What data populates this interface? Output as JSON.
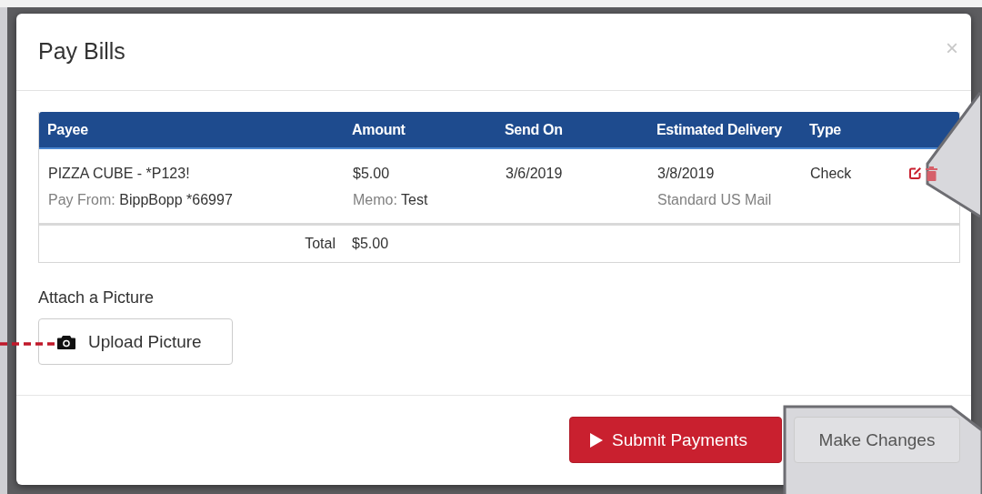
{
  "dialog": {
    "title": "Pay Bills",
    "close": "×"
  },
  "table": {
    "columns": [
      "Payee",
      "Amount",
      "Send On",
      "Estimated Delivery",
      "Type"
    ],
    "rows": [
      {
        "payee": "PIZZA CUBE - *P123!",
        "pay_from_label": "Pay From:",
        "pay_from": "BippBopp *66997",
        "amount": "$5.00",
        "memo_label": "Memo:",
        "memo": "Test",
        "send_on": "3/6/2019",
        "delivery_date": "3/8/2019",
        "delivery_method": "Standard US Mail",
        "type": "Check"
      }
    ],
    "total_label": "Total",
    "total": "$5.00"
  },
  "attach": {
    "label": "Attach a Picture",
    "button": "Upload Picture"
  },
  "buttons": [
    {
      "label": "Submit Payments",
      "kind": "primary"
    },
    {
      "label": "Make Changes",
      "kind": "secondary"
    }
  ]
}
